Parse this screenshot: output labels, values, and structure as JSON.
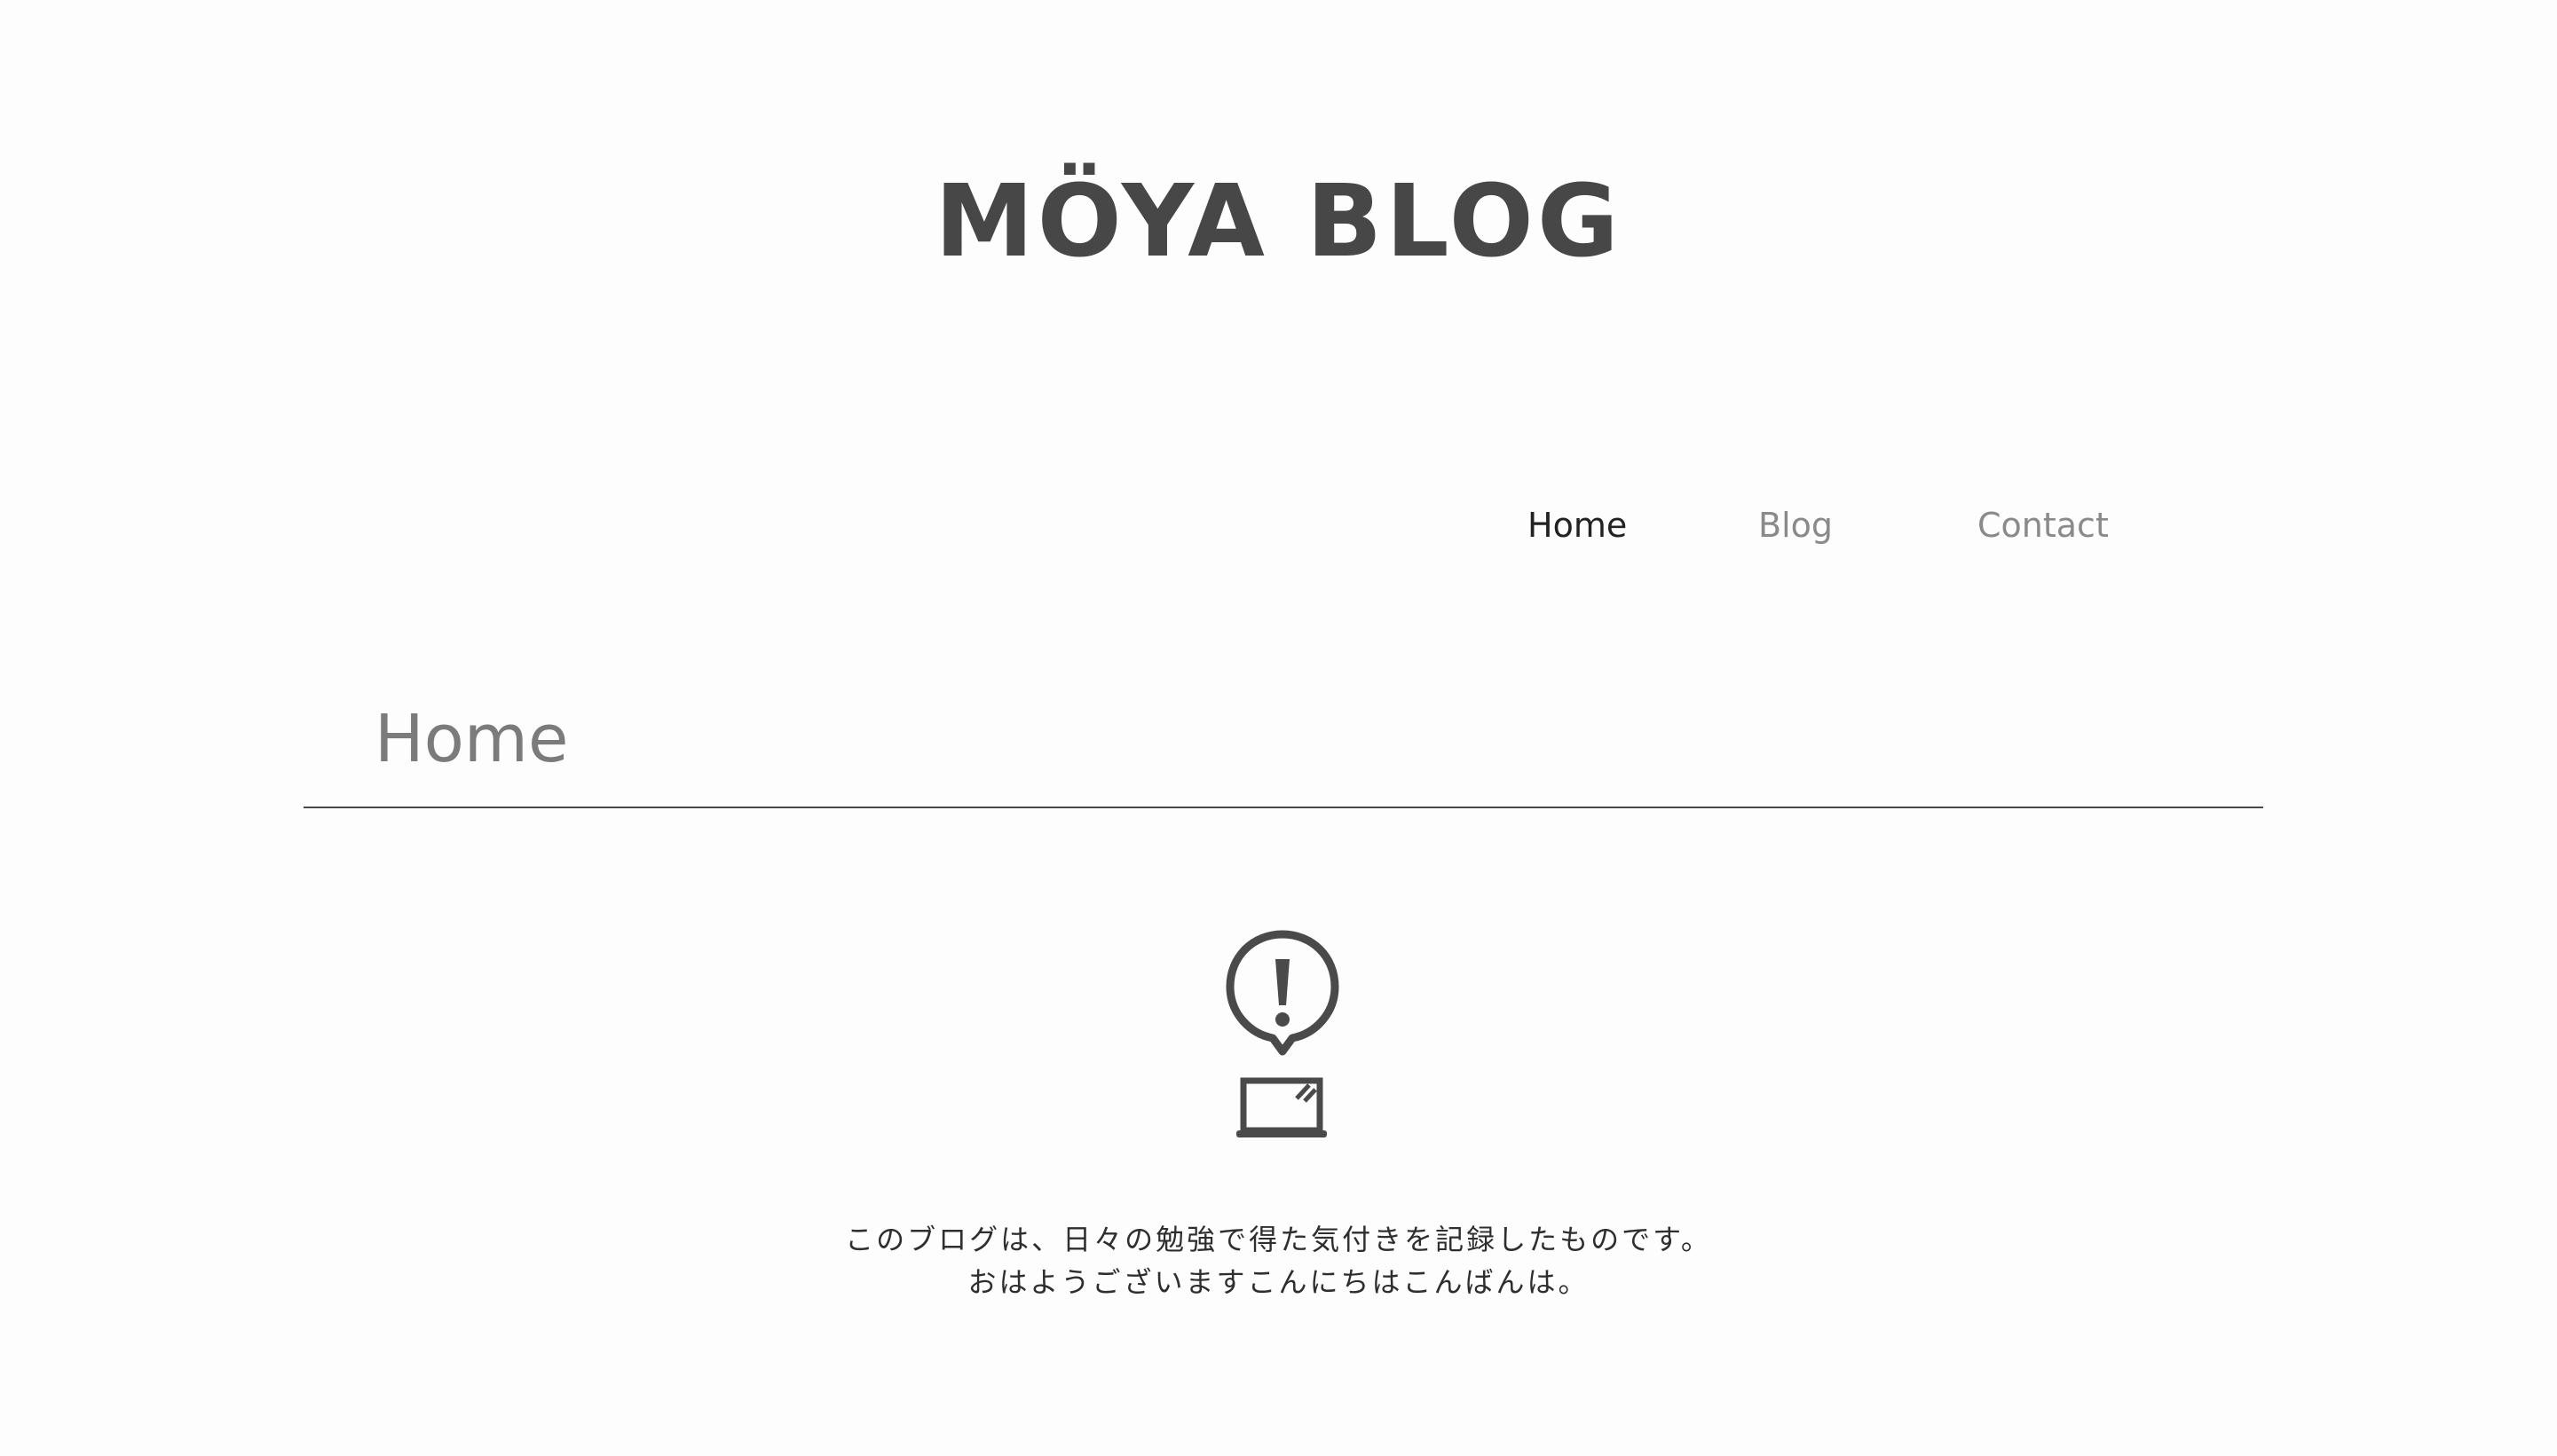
{
  "header": {
    "logo_text": "MÖYA  BLOG"
  },
  "nav": {
    "items": [
      {
        "label": "Home",
        "active": true
      },
      {
        "label": "Blog",
        "active": false
      },
      {
        "label": "Contact",
        "active": false
      }
    ]
  },
  "main": {
    "section_title": "Home",
    "hero_icon": "alert-speech-bubble-laptop-icon",
    "description_lines": [
      "このブログは、日々の勉強で得た気付きを記録したものです。",
      "おはようございますこんにちはこんばんは。"
    ]
  },
  "colors": {
    "text_dark": "#474747",
    "text_muted": "#8a8a8a",
    "background": "#fdfdfd"
  }
}
